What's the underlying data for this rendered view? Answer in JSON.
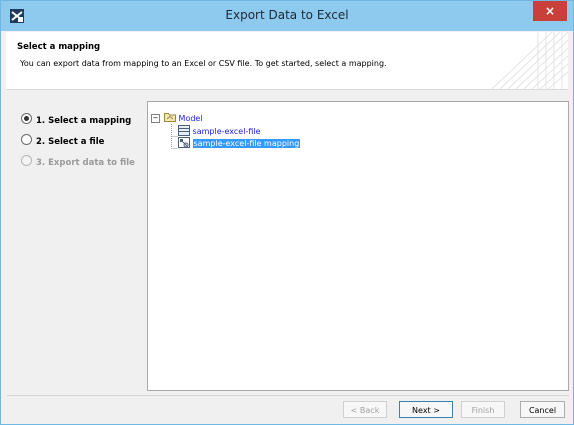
{
  "window": {
    "title": "Export Data to Excel",
    "close_glyph": "×"
  },
  "header": {
    "title": "Select a mapping",
    "description": "You can export data from mapping to an Excel or CSV file. To get started, select a mapping."
  },
  "steps": [
    {
      "label": "1. Select a mapping",
      "state": "selected"
    },
    {
      "label": "2. Select a file",
      "state": "enabled"
    },
    {
      "label": "3. Export data to file",
      "state": "disabled"
    }
  ],
  "tree": {
    "expander": "−",
    "root": {
      "label": "Model",
      "icon": "package-icon"
    },
    "children": [
      {
        "label": "sample-excel-file",
        "icon": "excel-file-icon",
        "selected": false
      },
      {
        "label": "sample-excel-file mapping",
        "icon": "mapping-icon",
        "selected": true
      }
    ]
  },
  "buttons": {
    "back": "< Back",
    "next": "Next >",
    "finish": "Finish",
    "cancel": "Cancel"
  },
  "colors": {
    "titlebar": "#8ec9ee",
    "close": "#c9403a",
    "selection": "#3399ff",
    "tree_text": "#1a1aff"
  }
}
